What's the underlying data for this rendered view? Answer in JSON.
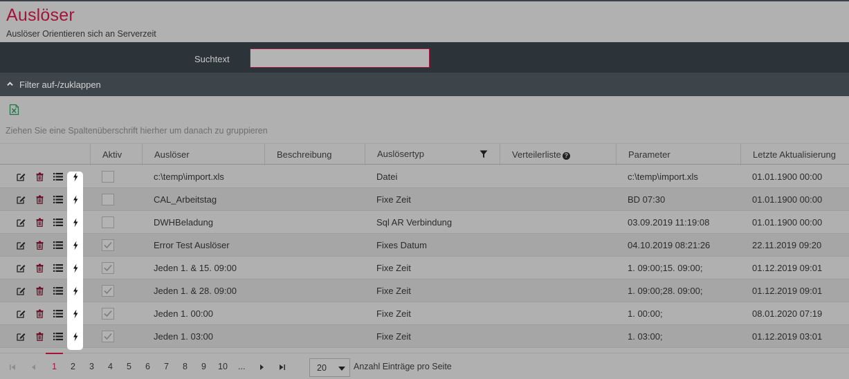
{
  "header": {
    "title": "Auslöser",
    "subtitle": "Auslöser Orientieren sich an Serverzeit"
  },
  "search": {
    "label": "Suchtext",
    "value": "",
    "placeholder": ""
  },
  "filter": {
    "toggle_label": "Filter auf-/zuklappen"
  },
  "toolbar": {
    "export_icon": "excel-export-icon"
  },
  "grid": {
    "group_hint": "Ziehen Sie eine Spaltenüberschrift hierher um danach zu gruppieren",
    "columns": {
      "aktiv": "Aktiv",
      "ausloeser": "Auslöser",
      "beschreibung": "Beschreibung",
      "ausloesertyp": "Auslösertyp",
      "verteilerliste": "Verteilerliste",
      "parameter": "Parameter",
      "letzte": "Letzte Aktualisierung"
    },
    "rows": [
      {
        "aktiv": false,
        "name": "c:\\temp\\import.xls",
        "beschreibung": "",
        "typ": "Datei",
        "verteiler": "",
        "parameter": "c:\\temp\\import.xls",
        "letzte": "01.01.1900 00:00"
      },
      {
        "aktiv": false,
        "name": "CAL_Arbeitstag",
        "beschreibung": "",
        "typ": "Fixe Zeit",
        "verteiler": "",
        "parameter": "BD 07:30",
        "letzte": "01.01.1900 00:00"
      },
      {
        "aktiv": false,
        "name": "DWHBeladung",
        "beschreibung": "",
        "typ": "Sql AR Verbindung",
        "verteiler": "",
        "parameter": "03.09.2019 11:19:08",
        "letzte": "01.01.1900 00:00"
      },
      {
        "aktiv": true,
        "name": "Error Test Auslöser",
        "beschreibung": "",
        "typ": "Fixes Datum",
        "verteiler": "",
        "parameter": "04.10.2019 08:21:26",
        "letzte": "22.11.2019 09:20"
      },
      {
        "aktiv": true,
        "name": "Jeden 1. & 15. 09:00",
        "beschreibung": "",
        "typ": "Fixe Zeit",
        "verteiler": "",
        "parameter": "1. 09:00;15. 09:00;",
        "letzte": "01.12.2019 09:01"
      },
      {
        "aktiv": true,
        "name": "Jeden 1. & 28. 09:00",
        "beschreibung": "",
        "typ": "Fixe Zeit",
        "verteiler": "",
        "parameter": "1. 09:00;28. 09:00;",
        "letzte": "01.12.2019 09:01"
      },
      {
        "aktiv": true,
        "name": "Jeden 1. 00:00",
        "beschreibung": "",
        "typ": "Fixe Zeit",
        "verteiler": "",
        "parameter": "1. 00:00;",
        "letzte": "08.01.2020 07:19"
      },
      {
        "aktiv": true,
        "name": "Jeden 1. 03:00",
        "beschreibung": "",
        "typ": "Fixe Zeit",
        "verteiler": "",
        "parameter": "1. 03:00;",
        "letzte": "01.12.2019 03:01"
      }
    ]
  },
  "pager": {
    "pages": [
      "1",
      "2",
      "3",
      "4",
      "5",
      "6",
      "7",
      "8",
      "9",
      "10",
      "..."
    ],
    "current_page": "1",
    "page_size": "20",
    "page_size_label": "Anzahl Einträge pro Seite"
  },
  "colors": {
    "accent": "#a2143a",
    "header_bg": "#b1b1b1",
    "dark_bar": "#2d3439",
    "filter_bar": "#3d454b",
    "excel_green": "#217346"
  }
}
